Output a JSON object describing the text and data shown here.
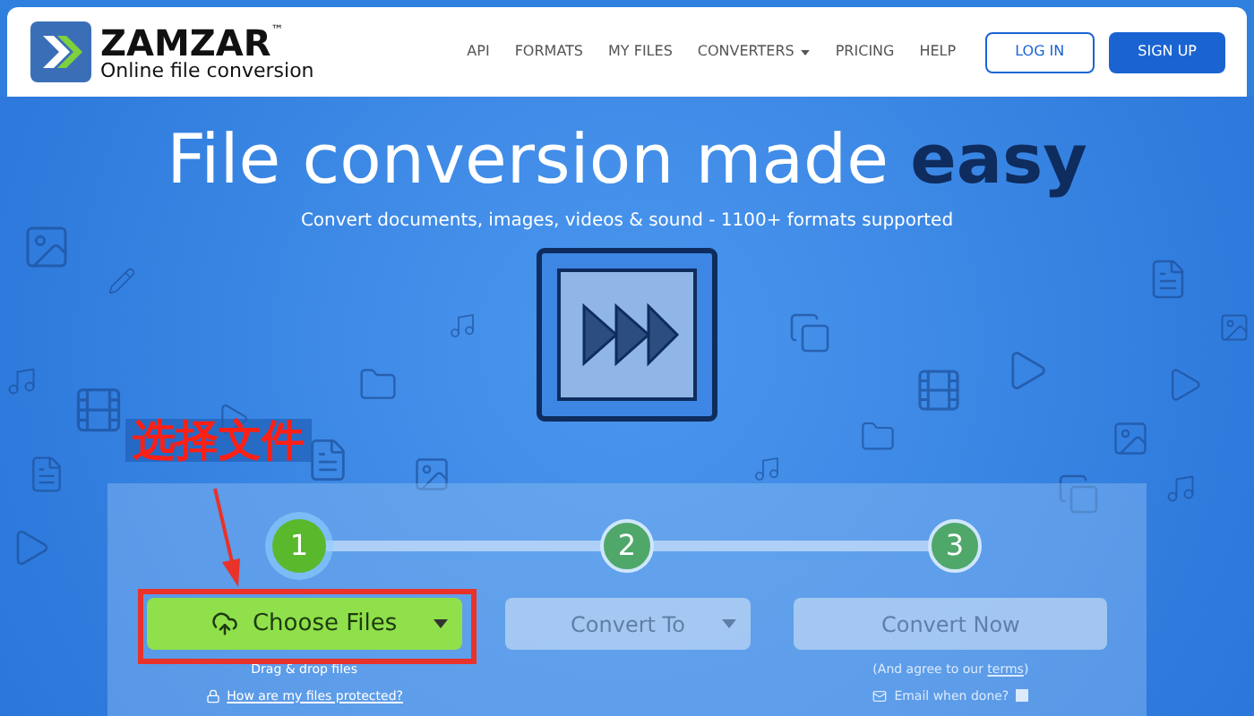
{
  "header": {
    "logo": {
      "name": "ZAMZAR",
      "trademark": "™",
      "tagline": "Online file conversion"
    },
    "nav": [
      {
        "label": "API",
        "dropdown": false
      },
      {
        "label": "FORMATS",
        "dropdown": false
      },
      {
        "label": "MY FILES",
        "dropdown": false
      },
      {
        "label": "CONVERTERS",
        "dropdown": true
      },
      {
        "label": "PRICING",
        "dropdown": false
      },
      {
        "label": "HELP",
        "dropdown": false
      }
    ],
    "buttons": [
      {
        "label": "LOG IN",
        "kind": "outline"
      },
      {
        "label": "SIGN UP",
        "kind": "solid"
      }
    ]
  },
  "hero": {
    "title": "File conversion made **easy**",
    "subtitle": "Convert documents, images, videos & sound - 1100+ formats supported"
  },
  "steps": [
    {
      "number": "1",
      "selected": true
    },
    {
      "number": "2",
      "selected": false
    },
    {
      "number": "3",
      "selected": false
    }
  ],
  "actions": [
    {
      "label": "Choose Files",
      "dropdown": true,
      "note": "Drag & drop files",
      "link": "How are my files protected?"
    },
    {
      "label": "Convert To",
      "dropdown": true
    },
    {
      "label": "Convert Now",
      "dropdown": false,
      "note_prefix": "(And agree to our ",
      "note_link": "terms",
      "note_suffix": ")",
      "email": {
        "label": "Email when done?",
        "checked": false
      }
    }
  ],
  "annotation": {
    "text": "选择文件"
  }
}
